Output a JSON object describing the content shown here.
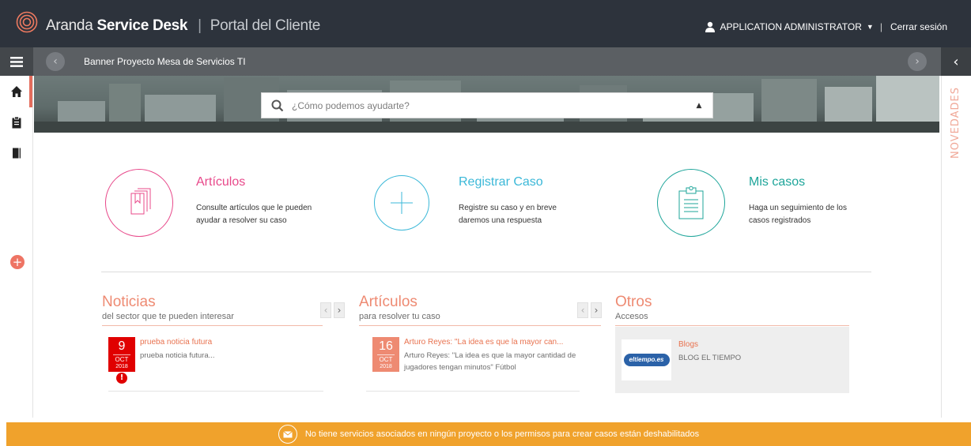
{
  "header": {
    "brand_light": "Aranda",
    "brand_bold": "Service Desk",
    "separator": "|",
    "portal": "Portal del Cliente",
    "user_name": "APPLICATION ADMINISTRATOR",
    "logout": "Cerrar sesión"
  },
  "banner": {
    "title": "Banner Proyecto Mesa de Servicios TI"
  },
  "search": {
    "placeholder": "¿Cómo podemos ayudarte?"
  },
  "right_panel": {
    "label": "NOVEDADES"
  },
  "features": [
    {
      "title": "Artículos",
      "desc": "Consulte artículos que le pueden ayudar a resolver su caso",
      "color": "#e8488a"
    },
    {
      "title": "Registrar Caso",
      "desc": "Registre su caso y en breve daremos una respuesta",
      "color": "#3bb8d8"
    },
    {
      "title": "Mis casos",
      "desc": "Haga un seguimiento de los casos registrados",
      "color": "#1ea59a"
    }
  ],
  "news": {
    "title": "Noticias",
    "subtitle": "del sector que te pueden interesar",
    "item": {
      "day": "9",
      "month": "OCT",
      "year": "2018",
      "title": "prueba noticia futura",
      "text": "prueba noticia futura..."
    }
  },
  "articles": {
    "title": "Artículos",
    "subtitle": "para resolver tu caso",
    "item": {
      "day": "16",
      "month": "OCT",
      "year": "2018",
      "title": "Arturo Reyes: \"La idea es que la mayor can...",
      "text": "Arturo Reyes: \"La idea es que la mayor cantidad de jugadores tengan minutos\" Fútbol"
    }
  },
  "others": {
    "title": "Otros",
    "subtitle": "Accesos",
    "item": {
      "logo_text": "eltiempo.es",
      "title": "Blogs",
      "text": "BLOG EL TIEMPO"
    }
  },
  "alert": {
    "text": "No tiene servicios asociados en ningún proyecto o los permisos para crear casos están deshabilitados"
  },
  "colors": {
    "topbar": "#2d333c",
    "accent": "#ee8a72",
    "alert": "#f0a22c",
    "news_badge": "#e00000",
    "article_badge": "#ee8a72"
  }
}
